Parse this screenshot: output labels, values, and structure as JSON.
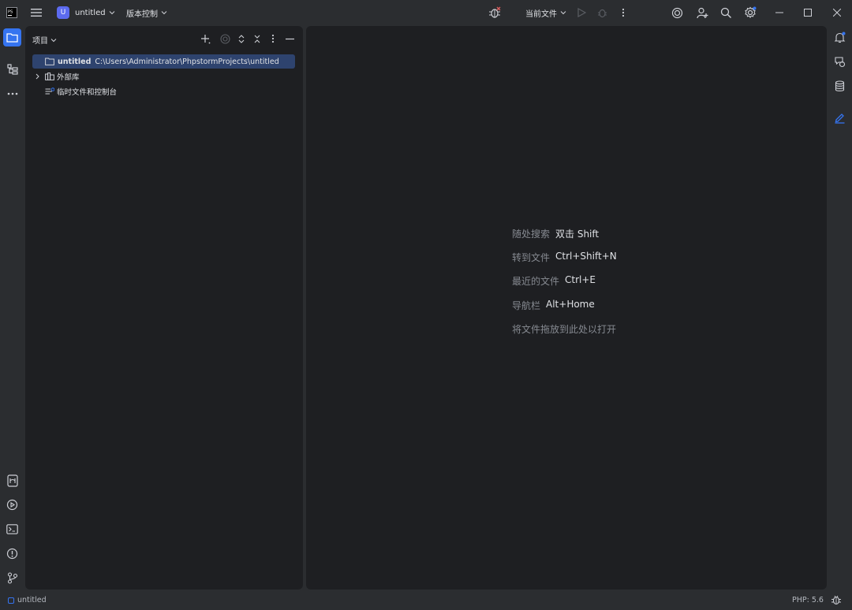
{
  "titlebar": {
    "project_badge": "U",
    "project_name": "untitled",
    "vcs_label": "版本控制",
    "run_config": "当前文件"
  },
  "project_panel": {
    "title": "项目",
    "tree": [
      {
        "name": "untitled",
        "path": "C:\\Users\\Administrator\\PhpstormProjects\\untitled"
      },
      {
        "name": "外部库"
      },
      {
        "name": "临时文件和控制台"
      }
    ]
  },
  "editor_hints": [
    {
      "label": "随处搜索",
      "shortcut": "双击 Shift"
    },
    {
      "label": "转到文件",
      "shortcut": "Ctrl+Shift+N"
    },
    {
      "label": "最近的文件",
      "shortcut": "Ctrl+E"
    },
    {
      "label": "导航栏",
      "shortcut": "Alt+Home"
    },
    {
      "label": "将文件拖放到此处以打开",
      "shortcut": ""
    }
  ],
  "statusbar": {
    "project": "untitled",
    "php_version": "PHP: 5.6"
  },
  "colors": {
    "accent": "#3574f0",
    "background": "#2b2d30",
    "panel": "#1e1f22",
    "selection": "#2e436e",
    "badge": "#5c6bf0"
  }
}
